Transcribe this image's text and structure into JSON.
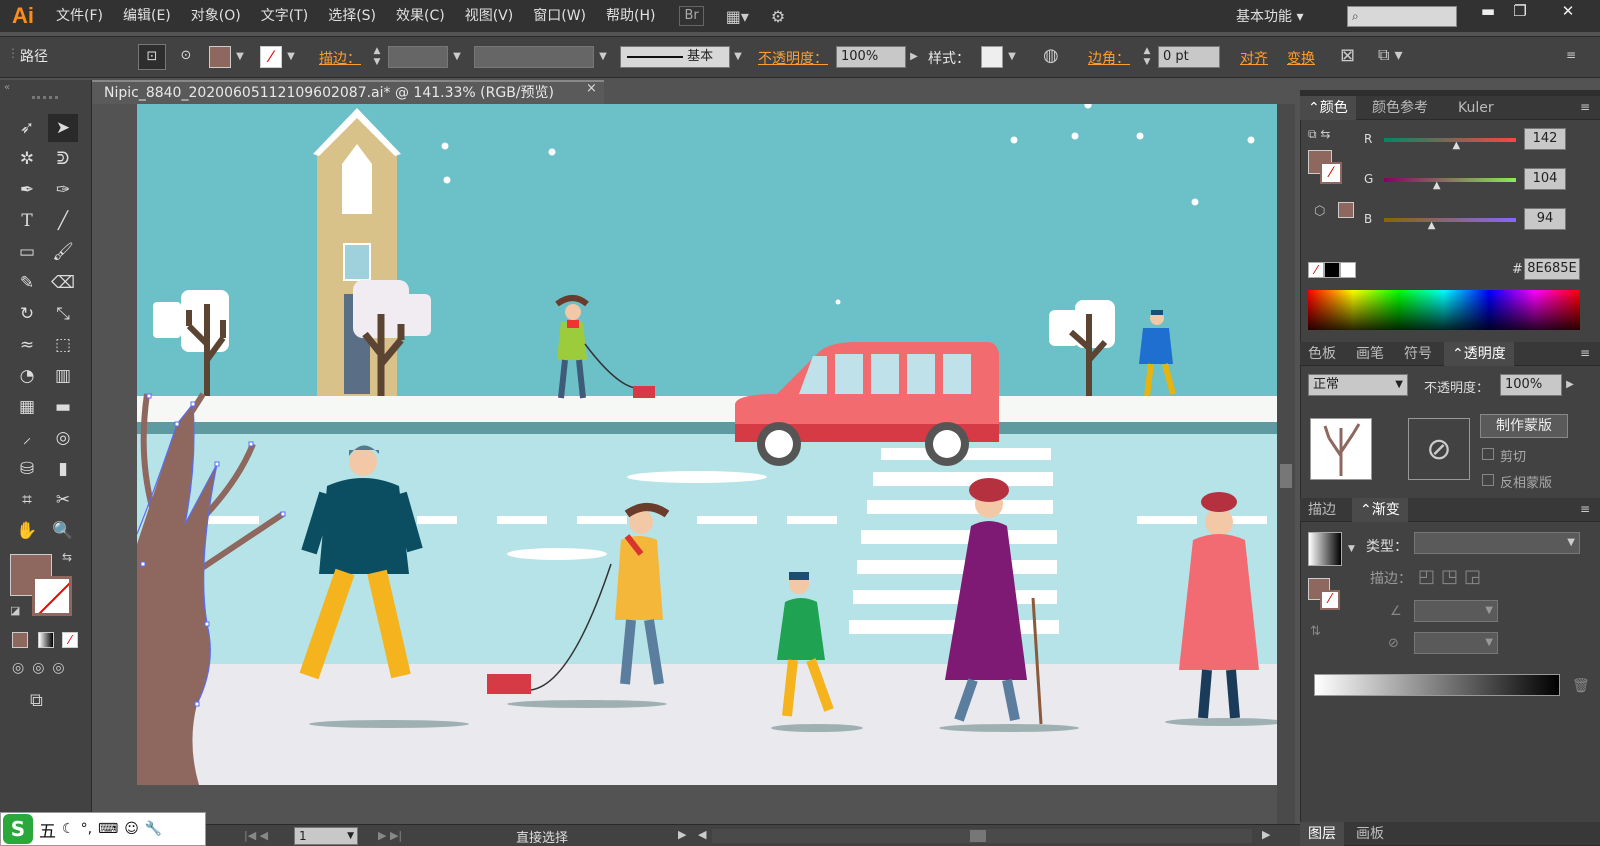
{
  "app": {
    "logo": "Ai"
  },
  "menu": [
    "文件(F)",
    "编辑(E)",
    "对象(O)",
    "文字(T)",
    "选择(S)",
    "效果(C)",
    "视图(V)",
    "窗口(W)",
    "帮助(H)"
  ],
  "menu_extra": {
    "bridge": "Br"
  },
  "workspace": {
    "label": "基本功能"
  },
  "search": {
    "placeholder": ""
  },
  "control": {
    "selection_label": "路径",
    "stroke_label": "描边：",
    "stroke_style": "基本",
    "opacity_label": "不透明度：",
    "opacity_value": "100%",
    "style_label": "样式：",
    "corner_label": "边角：",
    "corner_value": "0 pt",
    "align_label": "对齐",
    "transform_label": "变换"
  },
  "document": {
    "tab_title": "Nipic_8840_20200605112109602087.ai* @ 141.33% (RGB/预览)"
  },
  "color_panel": {
    "tabs": [
      "颜色",
      "颜色参考",
      "Kuler"
    ],
    "r_label": "R",
    "g_label": "G",
    "b_label": "B",
    "r": "142",
    "g": "104",
    "b": "94",
    "r_level": 0.557,
    "g_level": 0.408,
    "b_level": 0.369,
    "hex_prefix": "#",
    "hex": "8E685E"
  },
  "transparency_panel": {
    "tabs": [
      "色板",
      "画笔",
      "符号",
      "透明度"
    ],
    "blend_mode": "正常",
    "opacity_label": "不透明度：",
    "opacity_value": "100%",
    "make_mask": "制作蒙版",
    "clip": "剪切",
    "invert_mask": "反相蒙版"
  },
  "gradient_panel": {
    "tabs": [
      "描边",
      "渐变"
    ],
    "type_label": "类型：",
    "stroke_label": "描边："
  },
  "layers_panel": {
    "tabs": [
      "图层",
      "画板"
    ]
  },
  "status": {
    "page": "1",
    "tool": "直接选择"
  },
  "ime": {
    "label": "五"
  },
  "colors": {
    "fill": "#8E685E",
    "sky": "#6cc0c7",
    "road": "#b5e3e8",
    "sidewalk": "#e9e9ee"
  }
}
